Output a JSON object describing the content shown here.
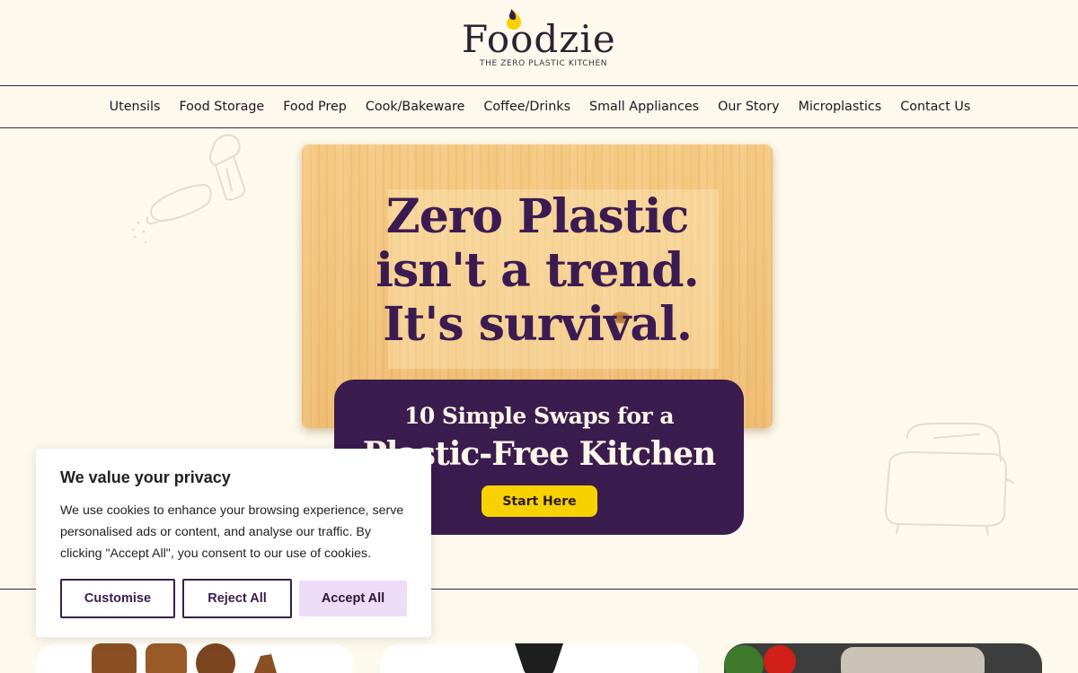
{
  "brand": {
    "name": "Foodzie",
    "tagline": "THE ZERO PLASTIC KITCHEN",
    "drop_colors": [
      "#f8d100",
      "#3a1c4e"
    ]
  },
  "nav": {
    "items": [
      "Utensils",
      "Food Storage",
      "Food Prep",
      "Cook/Bakeware",
      "Coffee/Drinks",
      "Small Appliances",
      "Our Story",
      "Microplastics",
      "Contact Us"
    ]
  },
  "hero": {
    "title_lines": [
      "Zero Plastic",
      "isn't a trend.",
      "It's survival."
    ],
    "cta_line1": "10 Simple Swaps for a",
    "cta_line2": "Plastic-Free Kitchen",
    "cta_button": "Start Here"
  },
  "cookie_banner": {
    "title": "We value your privacy",
    "body": "We use cookies to enhance your browsing experience, serve personalised ads or content, and analyse our traffic. By clicking \"Accept All\", you consent to our use of cookies.",
    "customise": "Customise",
    "reject": "Reject All",
    "accept": "Accept All"
  },
  "decorations": [
    "salt-shaker-icon",
    "pepper-shaker-icon",
    "toaster-icon"
  ],
  "colors": {
    "background": "#fdf9ec",
    "brand_purple": "#3a1c4e",
    "accent_yellow": "#f8d100",
    "accept_bg": "#ecdcf8"
  }
}
